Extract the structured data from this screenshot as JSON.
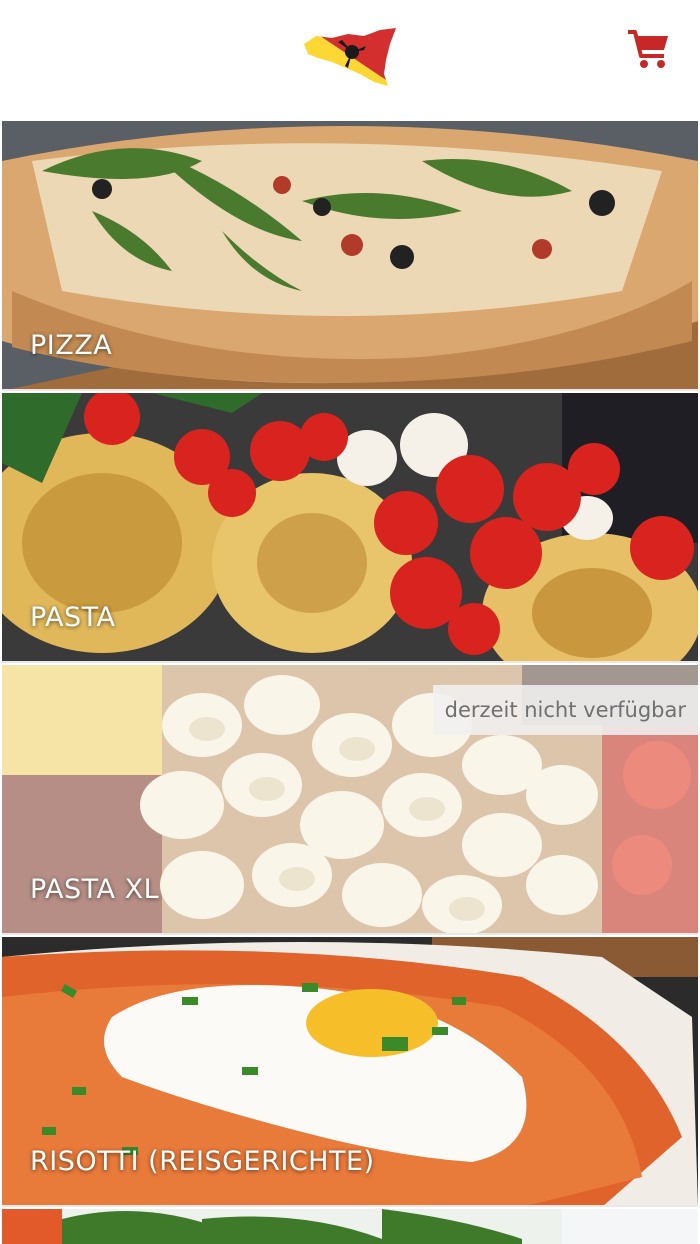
{
  "header": {
    "logo_icon": "sicily-trinacria-logo",
    "cart_icon": "shopping-cart-icon",
    "accent_color": "#c62828"
  },
  "categories": [
    {
      "label": "PIZZA",
      "available": true
    },
    {
      "label": "PASTA",
      "available": true
    },
    {
      "label": "PASTA XL",
      "available": false,
      "badge": "derzeit nicht verfügbar"
    },
    {
      "label": "RISOTTI (REISGERICHTE)",
      "available": true
    },
    {
      "label": "",
      "available": true
    }
  ]
}
